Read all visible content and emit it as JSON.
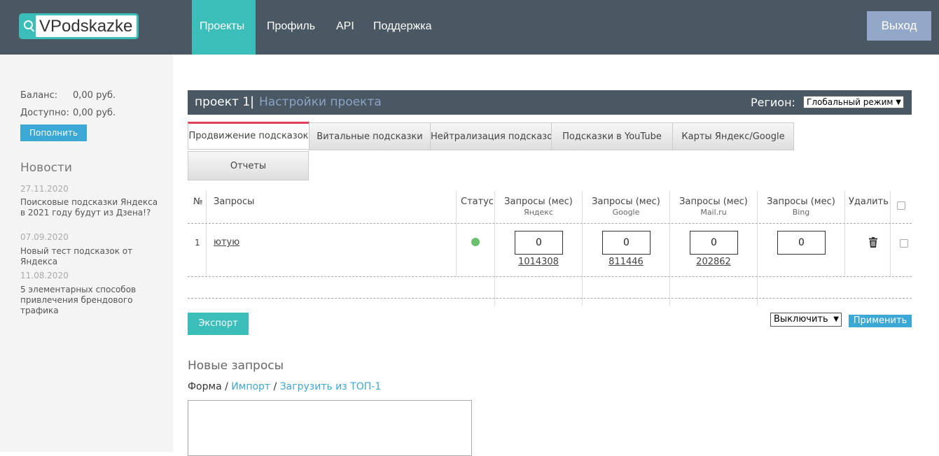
{
  "header": {
    "logo_text": "VPodskazke",
    "nav": [
      "Проекты",
      "Профиль",
      "API",
      "Поддержка"
    ],
    "active_nav": "Проекты",
    "logout_label": "Выход",
    "colors": {
      "bar": "#4a5863",
      "accent": "#3bbdb9",
      "logout": "#93a8c8"
    }
  },
  "sidebar": {
    "balance_label": "Баланс:",
    "balance_value": "0,00 руб.",
    "available_label": "Доступно:",
    "available_value": "0,00 руб.",
    "topup_label": "Пополнить",
    "news_title": "Новости",
    "news": [
      {
        "date": "27.11.2020",
        "text": "Поисковые подсказки Яндекса в 2021 году будут из Дзена!?"
      },
      {
        "date": "07.09.2020",
        "text": "Новый тест подсказок от Яндекса"
      },
      {
        "date": "11.08.2020",
        "text": "5 элементарных способов привлечения брендового трафика"
      }
    ]
  },
  "project": {
    "name": "проект 1",
    "separator": "|",
    "settings_link": "Настройки проекта",
    "region_label": "Регион:",
    "region_value": "Глобальный режим"
  },
  "tabs": [
    "Продвижение подсказок",
    "Витальные подсказки",
    "Нейтрализация подсказок",
    "Подсказки в YouTube",
    "Карты Яндекс/Google",
    "Отчеты"
  ],
  "active_tab": "Продвижение подсказок",
  "table": {
    "headers": {
      "num": "№",
      "queries": "Запросы",
      "status": "Статус",
      "req_label": "Запросы (мес)",
      "yandex": "Яндекс",
      "google": "Google",
      "mailru": "Mail.ru",
      "bing": "Bing",
      "delete": "Удалить"
    },
    "rows": [
      {
        "num": "1",
        "query": "ютую",
        "status": "active",
        "yandex_input": "0",
        "yandex_count": "1014308",
        "google_input": "0",
        "google_count": "811446",
        "mailru_input": "0",
        "mailru_count": "202862",
        "bing_input": "0"
      }
    ]
  },
  "actions": {
    "export_label": "Экспорт",
    "action_select": "Выключить",
    "apply_label": "Применить"
  },
  "new_queries": {
    "title": "Новые запросы",
    "form_label": "Форма",
    "sep": "/",
    "import_label": "Импорт",
    "top1_label": "Загрузить из ТОП-1"
  }
}
